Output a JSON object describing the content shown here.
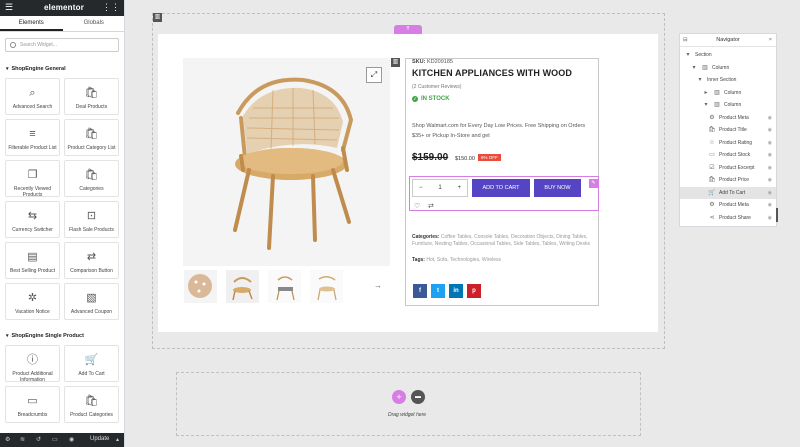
{
  "panel": {
    "logo": "elementor",
    "menu_icon": "hamburger-icon",
    "apps_icon": "grid-icon",
    "tabs": [
      "Elements",
      "Globals"
    ],
    "search_placeholder": "Search Widget...",
    "category1": "ShopEngine General",
    "widgets1": [
      {
        "label": "Advanced Search",
        "icon": "⌕"
      },
      {
        "label": "Deal Products",
        "icon": "🛍"
      },
      {
        "label": "Filterable Product List",
        "icon": "≡"
      },
      {
        "label": "Product Category List",
        "icon": "🛍"
      },
      {
        "label": "Recently Viewed Products",
        "icon": "❐"
      },
      {
        "label": "Categories",
        "icon": "🛍"
      },
      {
        "label": "Currency Switcher",
        "icon": "⇆"
      },
      {
        "label": "Flash Sale Products",
        "icon": "⊡"
      },
      {
        "label": "Best Selling Product",
        "icon": "▤"
      },
      {
        "label": "Comparison Button",
        "icon": "⇄"
      },
      {
        "label": "Vacation Notice",
        "icon": "✲"
      },
      {
        "label": "Advanced Coupon",
        "icon": "▧"
      }
    ],
    "category2": "ShopEngine Single Product",
    "widgets2": [
      {
        "label": "Product Additional Information",
        "icon": "ⓘ"
      },
      {
        "label": "Add To Cart",
        "icon": "🛒"
      },
      {
        "label": "Breadcrumbs",
        "icon": "▭"
      },
      {
        "label": "Product Categories",
        "icon": "🛍"
      }
    ],
    "footer_update": "Update"
  },
  "canvas": {
    "section_tab": "⠿",
    "sku_label": "SKU:",
    "sku_value": "KD209185",
    "title": "KITCHEN APPLIANCES WITH WOOD",
    "reviews": "(2 Customer Reviews)",
    "stock": "IN STOCK",
    "description": "Shop Walmart.com for Every Day Low Prices. Free Shipping on Orders $35+ or Pickup In-Store and get",
    "price_old": "$159.00",
    "price_new": "$150.00",
    "discount": "6% OFF",
    "qty_minus": "−",
    "qty_value": "1",
    "qty_plus": "+",
    "add_to_cart": "ADD TO CART",
    "buy_now": "BUY NOW",
    "categories_label": "Categories:",
    "categories_value": "Coffee Tables, Console Tables, Decoration Objects, Dining Tables, Furniture, Nesting Tables, Occasional Tables, Side Tables, Tables, Writing Desks",
    "tags_label": "Tags:",
    "tags_value": "Hot, Sofa, Technologies, Wireless",
    "social": [
      {
        "label": "f",
        "color": "#3b5998"
      },
      {
        "label": "t",
        "color": "#1da1f2"
      },
      {
        "label": "in",
        "color": "#0077b5"
      },
      {
        "label": "p",
        "color": "#cb2027"
      }
    ],
    "drop_text": "Drag widget here"
  },
  "navigator": {
    "title": "Navigator",
    "rows": [
      {
        "label": "Section",
        "icon": "",
        "indent": 0
      },
      {
        "label": "Column",
        "icon": "▥",
        "indent": 1
      },
      {
        "label": "Inner Section",
        "icon": "",
        "indent": 2
      },
      {
        "label": "Column",
        "icon": "▥",
        "indent": 3
      },
      {
        "label": "Column",
        "icon": "▥",
        "indent": 3
      },
      {
        "label": "Product Meta",
        "icon": "⚙",
        "indent": 4
      },
      {
        "label": "Product Title",
        "icon": "🛍",
        "indent": 4
      },
      {
        "label": "Product Rating",
        "icon": "☆",
        "indent": 4
      },
      {
        "label": "Product Stock",
        "icon": "▭",
        "indent": 4
      },
      {
        "label": "Product Excerpt",
        "icon": "☑",
        "indent": 4
      },
      {
        "label": "Product Price",
        "icon": "🛍",
        "indent": 4
      },
      {
        "label": "Add To Cart",
        "icon": "🛒",
        "indent": 4,
        "selected": true
      },
      {
        "label": "Product Meta",
        "icon": "⚙",
        "indent": 4
      },
      {
        "label": "Product Share",
        "icon": "⋖",
        "indent": 4
      }
    ]
  },
  "colors": {
    "accent": "#d67ee4",
    "button": "#5545c4",
    "stock": "#3da748"
  }
}
